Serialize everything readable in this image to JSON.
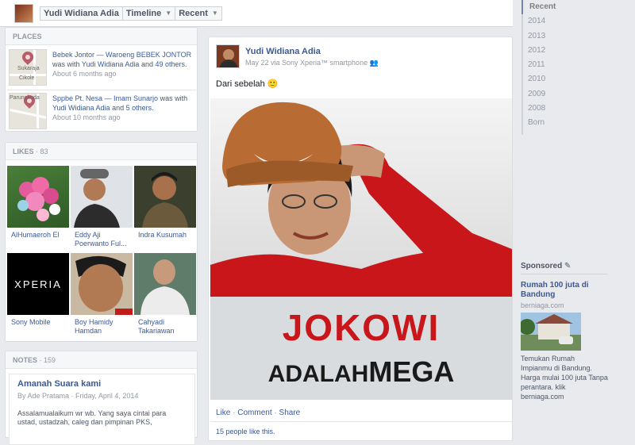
{
  "topbar": {
    "name": "Yudi Widiana Adia",
    "timeline": "Timeline",
    "recent": "Recent"
  },
  "places": {
    "header": "PLACES",
    "items": [
      {
        "place": "Bebek Jontor — Waroeng BEBEK JONTOR",
        "was_with": "was with",
        "person": "Yudi Widiana Adia",
        "and": "and",
        "others": "49 others.",
        "ago": "About 6 months ago",
        "map_label_1": "Sukaraja",
        "map_label_2": "Cikole"
      },
      {
        "place": "Sppbe Pt. Nesa — Imam Sunarjo",
        "was_with": "was with",
        "person": "Yudi Widiana Adia",
        "and": "and",
        "others": "5 others.",
        "ago": "About 10 months ago",
        "map_label_1": "Parungkuda",
        "map_label_2": ""
      }
    ]
  },
  "likes": {
    "header": "LIKES",
    "count": "· 83",
    "items": [
      {
        "label": "AlHumaeroh El"
      },
      {
        "label": "Eddy Aji Poerwanto Ful..."
      },
      {
        "label": "Indra Kusumah"
      },
      {
        "label": "Sony Mobile",
        "logo_text": "XPERIA"
      },
      {
        "label": "Boy Hamidy Hamdan"
      },
      {
        "label": "Cahyadi Takariawan"
      }
    ]
  },
  "notes": {
    "header": "NOTES",
    "count": "· 159",
    "title": "Amanah Suara kami",
    "meta": "By Ade Pratama · Friday, April 4, 2014",
    "body": "Assalamualaikum wr wb. Yang saya cintai para ustad, ustadzah, caleg dan pimpinan PKS,"
  },
  "post": {
    "author": "Yudi Widiana Adia",
    "meta": "May 22 via Sony Xperia™ smartphone",
    "text": "Dari sebelah 🙂",
    "poster_line1": "JOKOWI",
    "poster_line2a": "ADALAH",
    "poster_line2b": "MEGA",
    "like": "Like",
    "comment": "Comment",
    "share": "Share",
    "dot": "·",
    "like_count": "15 people like this."
  },
  "years": [
    "Recent",
    "2014",
    "2013",
    "2012",
    "2011",
    "2010",
    "2009",
    "2008",
    "Born"
  ],
  "sponsored": {
    "header": "Sponsored",
    "title": "Rumah 100 juta di Bandung",
    "domain": "berniaga.com",
    "body": "Temukan Rumah Impianmu di Bandung. Harga mulai 100 juta Tanpa perantara. klik berniaga.com"
  }
}
